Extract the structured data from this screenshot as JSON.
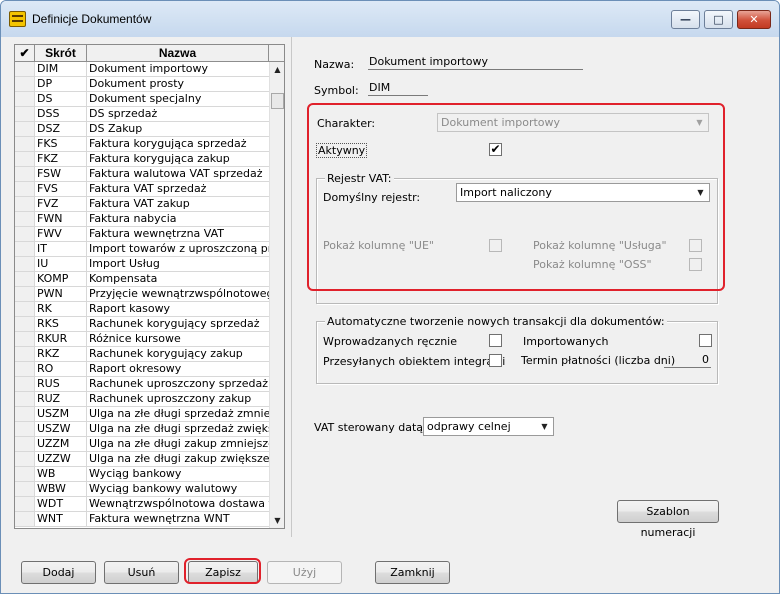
{
  "window": {
    "title": "Definicje Dokumentów"
  },
  "grid": {
    "headers": {
      "abbr": "Skrót",
      "name": "Nazwa"
    },
    "rows": [
      {
        "abbr": "DIM",
        "name": "Dokument importowy"
      },
      {
        "abbr": "DP",
        "name": "Dokument prosty"
      },
      {
        "abbr": "DS",
        "name": "Dokument specjalny"
      },
      {
        "abbr": "DSS",
        "name": "DS sprzedaż"
      },
      {
        "abbr": "DSZ",
        "name": "DS Zakup"
      },
      {
        "abbr": "FKS",
        "name": "Faktura korygująca sprzedaż"
      },
      {
        "abbr": "FKZ",
        "name": "Faktura korygująca zakup"
      },
      {
        "abbr": "FSW",
        "name": "Faktura walutowa VAT sprzedaż"
      },
      {
        "abbr": "FVS",
        "name": "Faktura VAT sprzedaż"
      },
      {
        "abbr": "FVZ",
        "name": "Faktura VAT zakup"
      },
      {
        "abbr": "FWN",
        "name": "Faktura nabycia"
      },
      {
        "abbr": "FWV",
        "name": "Faktura wewnętrzna VAT"
      },
      {
        "abbr": "IT",
        "name": "Import towarów z uproszczoną proce"
      },
      {
        "abbr": "IU",
        "name": "Import Usług"
      },
      {
        "abbr": "KOMP",
        "name": "Kompensata"
      },
      {
        "abbr": "PWN",
        "name": "Przyjęcie wewnątrzwspólnotowego n"
      },
      {
        "abbr": "RK",
        "name": "Raport kasowy"
      },
      {
        "abbr": "RKS",
        "name": "Rachunek korygujący sprzedaż"
      },
      {
        "abbr": "RKUR",
        "name": "Różnice kursowe"
      },
      {
        "abbr": "RKZ",
        "name": "Rachunek korygujący zakup"
      },
      {
        "abbr": "RO",
        "name": "Raport okresowy"
      },
      {
        "abbr": "RUS",
        "name": "Rachunek uproszczony sprzedaż"
      },
      {
        "abbr": "RUZ",
        "name": "Rachunek uproszczony zakup"
      },
      {
        "abbr": "USZM",
        "name": "Ulga na złe długi sprzedaż zmniejsze"
      },
      {
        "abbr": "USZW",
        "name": "Ulga na złe długi sprzedaż zwiększe"
      },
      {
        "abbr": "UZZM",
        "name": "Ulga na złe długi zakup zmniejszenie"
      },
      {
        "abbr": "UZZW",
        "name": "Ulga na złe długi zakup zwiększenie"
      },
      {
        "abbr": "WB",
        "name": "Wyciąg bankowy"
      },
      {
        "abbr": "WBW",
        "name": "Wyciąg bankowy walutowy"
      },
      {
        "abbr": "WDT",
        "name": "Wewnątrzwspólnotowa dostawa tow"
      },
      {
        "abbr": "WNT",
        "name": "Faktura wewnętrzna WNT"
      }
    ]
  },
  "form": {
    "name_label": "Nazwa:",
    "name_value": "Dokument importowy",
    "symbol_label": "Symbol:",
    "symbol_value": "DIM",
    "character_label": "Charakter:",
    "character_value": "Dokument importowy",
    "active_label": "Aktywny",
    "active_checked": true,
    "vat_register": {
      "legend": "Rejestr VAT:",
      "default_label": "Domyślny rejestr:",
      "default_value": "Import  naliczony",
      "show_ue_label": "Pokaż kolumnę \"UE\"",
      "show_service_label": "Pokaż kolumnę \"Usługa\"",
      "show_oss_label": "Pokaż kolumnę \"OSS\""
    },
    "auto_tx": {
      "legend": "Automatyczne tworzenie nowych transakcji dla dokumentów:",
      "manual_label": "Wprowadzanych ręcznie",
      "imported_label": "Importowanych",
      "integration_label": "Przesyłanych obiektem integracji",
      "payment_term_label": "Termin płatności (liczba dni)",
      "payment_term_value": "0"
    },
    "vat_date_label": "VAT sterowany datą:",
    "vat_date_value": "odprawy celnej",
    "numbering_button": "Szablon numeracji"
  },
  "buttons": {
    "add": "Dodaj",
    "delete": "Usuń",
    "save": "Zapisz",
    "use": "Użyj",
    "close": "Zamknij"
  },
  "highlight_color": "#e0212b"
}
